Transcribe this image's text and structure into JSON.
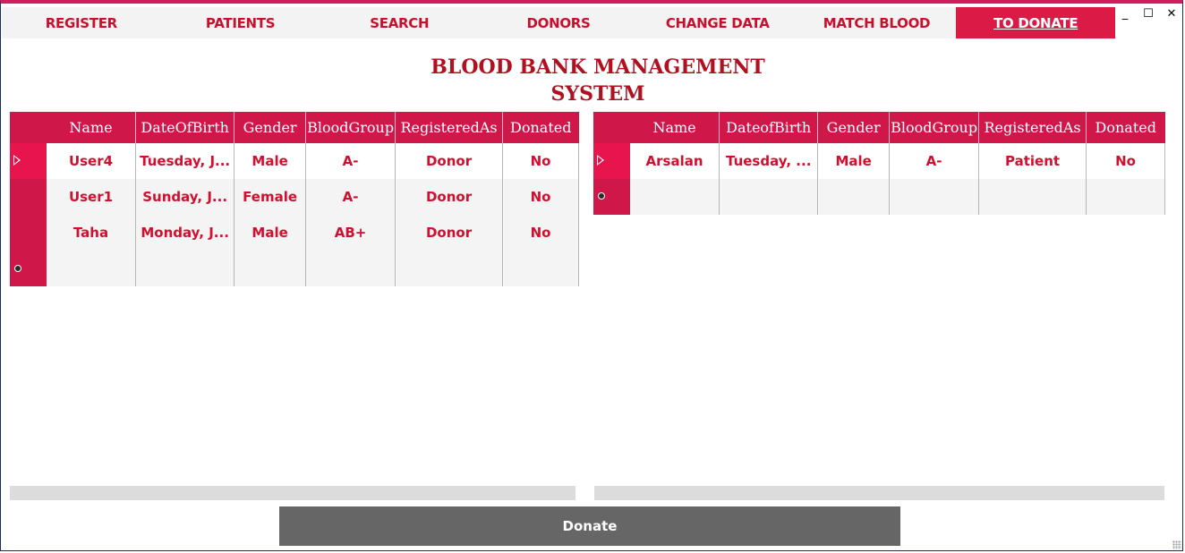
{
  "nav": {
    "items": [
      {
        "label": "Register"
      },
      {
        "label": "Patients"
      },
      {
        "label": "Search"
      },
      {
        "label": "Donors"
      },
      {
        "label": "Change Data"
      },
      {
        "label": "Match Blood"
      },
      {
        "label": "To Donate",
        "active": true
      }
    ]
  },
  "window": {
    "minimize": "_",
    "maximize": "☐",
    "close": "✕"
  },
  "title": {
    "line1": "Blood Bank Management",
    "line2": "System"
  },
  "donors_grid": {
    "columns": [
      "Name",
      "DateOfBirth",
      "Gender",
      "BloodGroup",
      "RegisteredAs",
      "Donated"
    ],
    "rows": [
      {
        "name": "User4",
        "dob": "Tuesday, J...",
        "gender": "Male",
        "blood": "A-",
        "registered": "Donor",
        "donated": "No"
      },
      {
        "name": "User1",
        "dob": "Sunday, J...",
        "gender": "Female",
        "blood": "A-",
        "registered": "Donor",
        "donated": "No"
      },
      {
        "name": "Taha",
        "dob": "Monday, J...",
        "gender": "Male",
        "blood": "AB+",
        "registered": "Donor",
        "donated": "No"
      }
    ]
  },
  "patients_grid": {
    "columns": [
      "Name",
      "DateofBirth",
      "Gender",
      "BloodGroup",
      "RegisteredAs",
      "Donated"
    ],
    "rows": [
      {
        "name": "Arsalan",
        "dob": "Tuesday, ...",
        "gender": "Male",
        "blood": "A-",
        "registered": "Patient",
        "donated": "No"
      }
    ]
  },
  "actions": {
    "donate_label": "Donate"
  },
  "colors": {
    "accent": "#dc1a46",
    "header": "#d0174a",
    "text_red": "#d0102e",
    "button": "#666666"
  }
}
